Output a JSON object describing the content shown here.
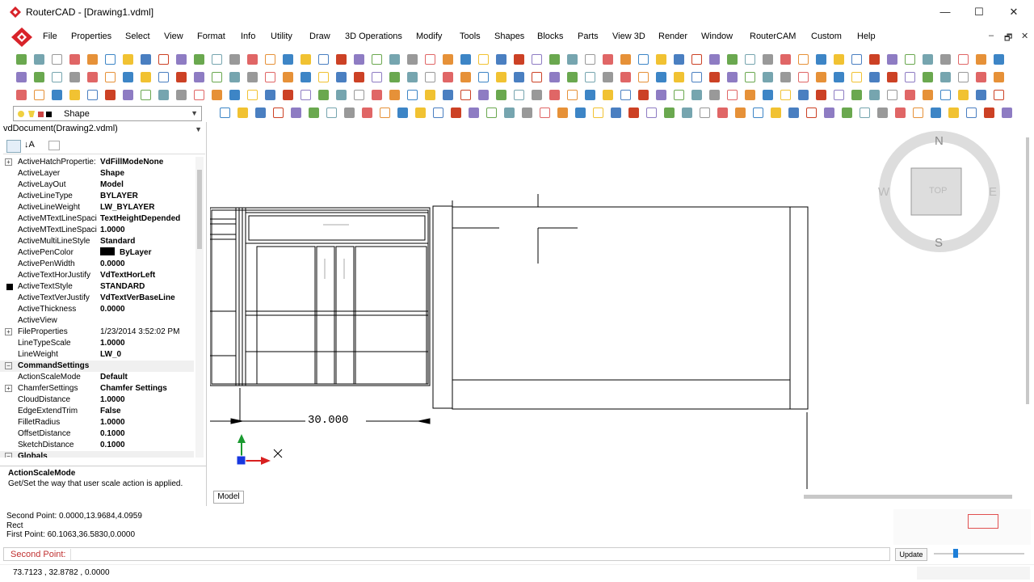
{
  "window": {
    "title": "RouterCAD - [Drawing1.vdml]",
    "min": "—",
    "max": "☐",
    "close": "✕"
  },
  "menu": {
    "items": [
      "File",
      "Properties",
      "Select",
      "View",
      "Format",
      "Info",
      "Utility",
      "Draw",
      "3D Operations",
      "Modify",
      "Tools",
      "Shapes",
      "Blocks",
      "Parts",
      "View 3D",
      "Render",
      "Window",
      "RouterCAM",
      "Custom",
      "Help"
    ],
    "mdi_min": "–",
    "mdi_restore": "🗗",
    "mdi_close": "✕"
  },
  "layer_box": {
    "value": "Shape"
  },
  "properties": {
    "document": "vdDocument(Drawing2.vdml)",
    "rows": [
      {
        "key": "ActiveHatchPropertie:",
        "value": "VdFillModeNone",
        "expand": true
      },
      {
        "key": "ActiveLayer",
        "value": "Shape"
      },
      {
        "key": "ActiveLayOut",
        "value": "Model"
      },
      {
        "key": "ActiveLineType",
        "value": "BYLAYER"
      },
      {
        "key": "ActiveLineWeight",
        "value": "LW_BYLAYER"
      },
      {
        "key": "ActiveMTextLineSpaci",
        "value": "TextHeightDepended"
      },
      {
        "key": "ActiveMTextLineSpaci",
        "value": "1.0000"
      },
      {
        "key": "ActiveMultiLineStyle",
        "value": "Standard"
      },
      {
        "key": "ActivePenColor",
        "value": "ByLayer",
        "swatch": true
      },
      {
        "key": "ActivePenWidth",
        "value": "0.0000"
      },
      {
        "key": "ActiveTextHorJustify",
        "value": "VdTextHorLeft"
      },
      {
        "key": "ActiveTextStyle",
        "value": "STANDARD"
      },
      {
        "key": "ActiveTextVerJustify",
        "value": "VdTextVerBaseLine"
      },
      {
        "key": "ActiveThickness",
        "value": "0.0000"
      },
      {
        "key": "ActiveView",
        "value": ""
      },
      {
        "key": "FileProperties",
        "value": "1/23/2014 3:52:02 PM",
        "expand": true,
        "normal": true
      },
      {
        "key": "LineTypeScale",
        "value": "1.0000"
      },
      {
        "key": "LineWeight",
        "value": "LW_0"
      },
      {
        "key": "CommandSettings",
        "value": "",
        "category": true
      },
      {
        "key": "ActionScaleMode",
        "value": "Default"
      },
      {
        "key": "ChamferSettings",
        "value": "Chamfer Settings",
        "expand": true
      },
      {
        "key": "CloudDistance",
        "value": "1.0000"
      },
      {
        "key": "EdgeExtendTrim",
        "value": "False"
      },
      {
        "key": "FilletRadius",
        "value": "1.0000"
      },
      {
        "key": "OffsetDistance",
        "value": "0.1000"
      },
      {
        "key": "SketchDistance",
        "value": "0.1000"
      },
      {
        "key": "Globals",
        "value": "",
        "category": true
      }
    ],
    "desc_title": "ActionScaleMode",
    "desc_text": "Get/Set the way that user scale action is applied."
  },
  "canvas": {
    "dimension_text": "30.000",
    "compass": {
      "n": "N",
      "s": "S",
      "e": "E",
      "w": "W",
      "cube": "TOP"
    },
    "model_tab": "Model"
  },
  "command": {
    "history": [
      "Second Point: 0.0000,13.9684,4.0959",
      "Rect",
      "First Point: 60.1063,36.5830,0.0000"
    ],
    "prompt": "Second Point:",
    "input_value": "",
    "update_button": "Update"
  },
  "status": {
    "coords": "73.7123 , 32.8782 , 0.0000"
  },
  "colors": {
    "accent_red": "#d8232a",
    "prompt_red": "#c03030",
    "slider_blue": "#1e7fd8"
  }
}
